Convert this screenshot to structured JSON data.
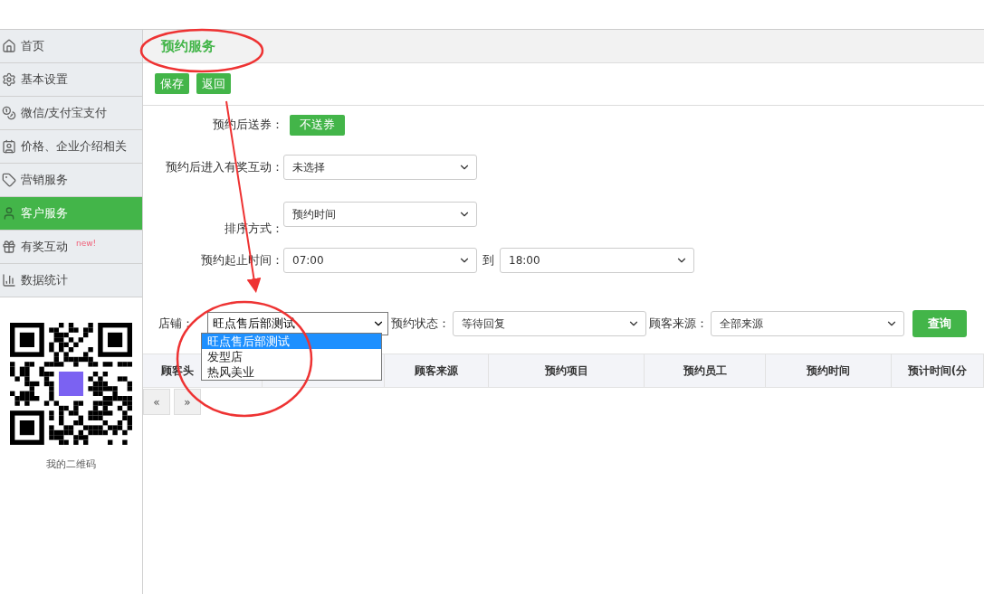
{
  "sidebar": {
    "items": [
      {
        "label": "首页",
        "selected": false
      },
      {
        "label": "基本设置",
        "selected": false
      },
      {
        "label": "微信/支付宝支付",
        "selected": false
      },
      {
        "label": "价格、企业介绍相关",
        "selected": false
      },
      {
        "label": "营销服务",
        "selected": false
      },
      {
        "label": "客户服务",
        "selected": true
      },
      {
        "label": "有奖互动",
        "selected": false,
        "badge": "new!"
      },
      {
        "label": "数据统计",
        "selected": false
      }
    ],
    "qr_caption": "我的二维码"
  },
  "page_title": "预约服务",
  "toolbar_buttons": [
    "保存",
    "返回"
  ],
  "form": {
    "coupon": {
      "label": "预约后送券：",
      "button": "不送券"
    },
    "interaction": {
      "label": "预约后进入有奖互动：",
      "value": "未选择"
    },
    "sort": {
      "label": "排序方式：",
      "value": "预约时间"
    },
    "time_range": {
      "label": "预约起止时间：",
      "start": "07:00",
      "separator": "到",
      "end": "18:00"
    }
  },
  "filters": {
    "store": {
      "label": "店铺：",
      "value": "旺点售后部测试",
      "expanded": true,
      "options": [
        {
          "label": "旺点售后部测试",
          "selected": true
        },
        {
          "label": "发型店",
          "selected": false
        },
        {
          "label": "热风美业",
          "selected": false
        }
      ]
    },
    "status": {
      "label": "预约状态：",
      "value": "等待回复"
    },
    "source": {
      "label": "顾客来源：",
      "value": "全部来源"
    },
    "search_button": "查询"
  },
  "table": {
    "columns": [
      "顾客头",
      "",
      "顾客来源",
      "预约项目",
      "预约员工",
      "预约时间",
      "预计时间(分"
    ]
  },
  "pagination": [
    "«",
    "»"
  ]
}
